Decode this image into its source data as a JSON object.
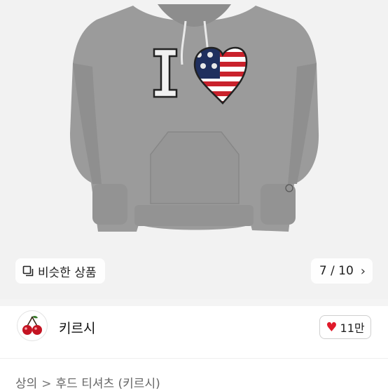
{
  "product": {
    "image_alt": "grey hoodie with I-heart print",
    "print_letter": "I"
  },
  "gallery": {
    "similar_label": "비슷한 상품",
    "counter": "7 / 10",
    "icons": {
      "similar": "stacked-squares-icon",
      "next": "chevron-right-icon"
    }
  },
  "seller": {
    "name": "키르시",
    "avatar_icon": "cherry-icon",
    "like_count": "11만",
    "like_icon": "heart-icon"
  },
  "breadcrumb": {
    "items": [
      "상의",
      "후드 티셔츠 (키르시)"
    ],
    "separator": ">"
  },
  "colors": {
    "heart": "#e01a2b",
    "hoodie": "#9a9a9a"
  }
}
